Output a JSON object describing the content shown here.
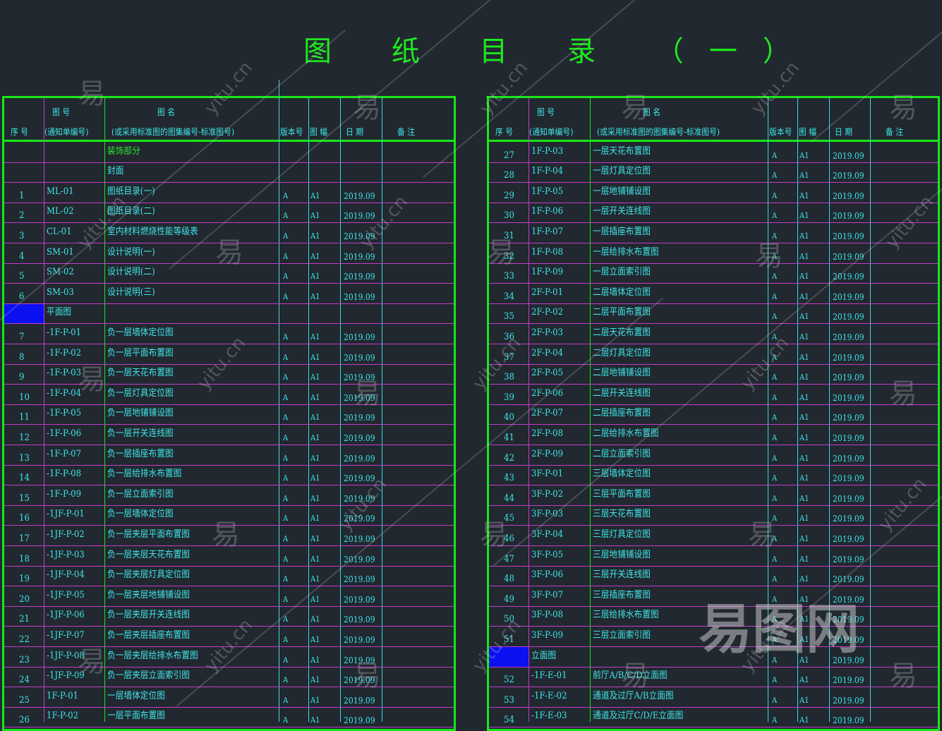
{
  "title": "图 纸 目 录 （一）",
  "colors": {
    "background": "#212830",
    "border": "#19e619",
    "grid": "#c23cc8",
    "text": "#3fe6e6",
    "section_marker": "#0a10f0"
  },
  "headers": {
    "no": "序 号",
    "code_top": "图  号",
    "code_bottom": "(通知单编号)",
    "name_top": "图        名",
    "name_bottom": "(或采用标准图的图集编号-标准图号)",
    "version": "版本号",
    "size": "图 幅",
    "date": "日 期",
    "remark": "备   注"
  },
  "left_rows": [
    {
      "section": "装饰部分",
      "type": "name",
      "color": "green"
    },
    {
      "section": "封面",
      "type": "name"
    },
    {
      "no": "1",
      "code": "ML-01",
      "name": "图纸目录(一)",
      "ver": "A",
      "size": "A1",
      "date": "2019.09"
    },
    {
      "no": "2",
      "code": "ML-02",
      "name": "图纸目录(二)",
      "ver": "A",
      "size": "A1",
      "date": "2019.09"
    },
    {
      "no": "3",
      "code": "CL-01",
      "name": "室内材料燃烧性能等级表",
      "ver": "A",
      "size": "A1",
      "date": "2019.09"
    },
    {
      "no": "4",
      "code": "SM-01",
      "name": "设计说明(一)",
      "ver": "A",
      "size": "A1",
      "date": "2019.09"
    },
    {
      "no": "5",
      "code": "SM-02",
      "name": "设计说明(二)",
      "ver": "A",
      "size": "A1",
      "date": "2019.09"
    },
    {
      "no": "6",
      "code": "SM-03",
      "name": "设计说明(三)",
      "ver": "A",
      "size": "A1",
      "date": "2019.09"
    },
    {
      "section": "平面图",
      "type": "code",
      "marker": true
    },
    {
      "no": "7",
      "code": "-1F-P-01",
      "name": "负一层墙体定位图",
      "ver": "A",
      "size": "A1",
      "date": "2019.09"
    },
    {
      "no": "8",
      "code": "-1F-P-02",
      "name": "负一层平面布置图",
      "ver": "A",
      "size": "A1",
      "date": "2019.09"
    },
    {
      "no": "9",
      "code": "-1F-P-03",
      "name": "负一层天花布置图",
      "ver": "A",
      "size": "A1",
      "date": "2019.09"
    },
    {
      "no": "10",
      "code": "-1F-P-04",
      "name": "负一层灯具定位图",
      "ver": "A",
      "size": "A1",
      "date": "2019.09"
    },
    {
      "no": "11",
      "code": "-1F-P-05",
      "name": "负一层地铺铺设图",
      "ver": "A",
      "size": "A1",
      "date": "2019.09"
    },
    {
      "no": "12",
      "code": "-1F-P-06",
      "name": "负一层开关连线图",
      "ver": "A",
      "size": "A1",
      "date": "2019.09"
    },
    {
      "no": "13",
      "code": "-1F-P-07",
      "name": "负一层插座布置图",
      "ver": "A",
      "size": "A1",
      "date": "2019.09"
    },
    {
      "no": "14",
      "code": "-1F-P-08",
      "name": "负一层给排水布置图",
      "ver": "A",
      "size": "A1",
      "date": "2019.09"
    },
    {
      "no": "15",
      "code": "-1F-P-09",
      "name": "负一层立面索引图",
      "ver": "A",
      "size": "A1",
      "date": "2019.09"
    },
    {
      "no": "16",
      "code": "-1JF-P-01",
      "name": "负一层墙体定位图",
      "ver": "A",
      "size": "A1",
      "date": "2019.09"
    },
    {
      "no": "17",
      "code": "-1JF-P-02",
      "name": "负一层夹层平面布置图",
      "ver": "A",
      "size": "A1",
      "date": "2019.09"
    },
    {
      "no": "18",
      "code": "-1JF-P-03",
      "name": "负一层夹层天花布置图",
      "ver": "A",
      "size": "A1",
      "date": "2019.09"
    },
    {
      "no": "19",
      "code": "-1JF-P-04",
      "name": "负一层夹层灯具定位图",
      "ver": "A",
      "size": "A1",
      "date": "2019.09"
    },
    {
      "no": "20",
      "code": "-1JF-P-05",
      "name": "负一层夹层地铺铺设图",
      "ver": "A",
      "size": "A1",
      "date": "2019.09"
    },
    {
      "no": "21",
      "code": "-1JF-P-06",
      "name": "负一层夹层开关连线图",
      "ver": "A",
      "size": "A1",
      "date": "2019.09"
    },
    {
      "no": "22",
      "code": "-1JF-P-07",
      "name": "负一层夹层插座布置图",
      "ver": "A",
      "size": "A1",
      "date": "2019.09"
    },
    {
      "no": "23",
      "code": "-1JF-P-08",
      "name": "负一层夹层给排水布置图",
      "ver": "A",
      "size": "A1",
      "date": "2019.09"
    },
    {
      "no": "24",
      "code": "-1JF-P-09",
      "name": "负一层夹层立面索引图",
      "ver": "A",
      "size": "A1",
      "date": "2019.09"
    },
    {
      "no": "25",
      "code": "1F-P-01",
      "name": "一层墙体定位图",
      "ver": "A",
      "size": "A1",
      "date": "2019.09"
    },
    {
      "no": "26",
      "code": "1F-P-02",
      "name": "一层平面布置图",
      "ver": "A",
      "size": "A1",
      "date": "2019.09"
    }
  ],
  "right_rows": [
    {
      "no": "27",
      "code": "1F-P-03",
      "name": "一层天花布置图",
      "ver": "A",
      "size": "A1",
      "date": "2019.09"
    },
    {
      "no": "28",
      "code": "1F-P-04",
      "name": "一层灯具定位图",
      "ver": "A",
      "size": "A1",
      "date": "2019.09"
    },
    {
      "no": "29",
      "code": "1F-P-05",
      "name": "一层地铺铺设图",
      "ver": "A",
      "size": "A1",
      "date": "2019.09"
    },
    {
      "no": "30",
      "code": "1F-P-06",
      "name": "一层开关连线图",
      "ver": "A",
      "size": "A1",
      "date": "2019.09"
    },
    {
      "no": "31",
      "code": "1F-P-07",
      "name": "一层插座布置图",
      "ver": "A",
      "size": "A1",
      "date": "2019.09"
    },
    {
      "no": "32",
      "code": "1F-P-08",
      "name": "一层给排水布置图",
      "ver": "A",
      "size": "A1",
      "date": "2019.09"
    },
    {
      "no": "33",
      "code": "1F-P-09",
      "name": "一层立面索引图",
      "ver": "A",
      "size": "A1",
      "date": "2019.09"
    },
    {
      "no": "34",
      "code": "2F-P-01",
      "name": "二层墙体定位图",
      "ver": "A",
      "size": "A1",
      "date": "2019.09"
    },
    {
      "no": "35",
      "code": "2F-P-02",
      "name": "二层平面布置图",
      "ver": "A",
      "size": "A1",
      "date": "2019.09"
    },
    {
      "no": "36",
      "code": "2F-P-03",
      "name": "二层天花布置图",
      "ver": "A",
      "size": "A1",
      "date": "2019.09"
    },
    {
      "no": "37",
      "code": "2F-P-04",
      "name": "二层灯具定位图",
      "ver": "A",
      "size": "A1",
      "date": "2019.09"
    },
    {
      "no": "38",
      "code": "2F-P-05",
      "name": "二层地铺铺设图",
      "ver": "A",
      "size": "A1",
      "date": "2019.09"
    },
    {
      "no": "39",
      "code": "2F-P-06",
      "name": "二层开关连线图",
      "ver": "A",
      "size": "A1",
      "date": "2019.09"
    },
    {
      "no": "40",
      "code": "2F-P-07",
      "name": "二层插座布置图",
      "ver": "A",
      "size": "A1",
      "date": "2019.09"
    },
    {
      "no": "41",
      "code": "2F-P-08",
      "name": "二层给排水布置图",
      "ver": "A",
      "size": "A1",
      "date": "2019.09"
    },
    {
      "no": "42",
      "code": "2F-P-09",
      "name": "二层立面索引图",
      "ver": "A",
      "size": "A1",
      "date": "2019.09"
    },
    {
      "no": "43",
      "code": "3F-P-01",
      "name": "三层墙体定位图",
      "ver": "A",
      "size": "A1",
      "date": "2019.09"
    },
    {
      "no": "44",
      "code": "3F-P-02",
      "name": "三层平面布置图",
      "ver": "A",
      "size": "A1",
      "date": "2019.09"
    },
    {
      "no": "45",
      "code": "3F-P-03",
      "name": "三层天花布置图",
      "ver": "A",
      "size": "A1",
      "date": "2019.09"
    },
    {
      "no": "46",
      "code": "3F-P-04",
      "name": "三层灯具定位图",
      "ver": "A",
      "size": "A1",
      "date": "2019.09"
    },
    {
      "no": "47",
      "code": "3F-P-05",
      "name": "三层地铺铺设图",
      "ver": "A",
      "size": "A1",
      "date": "2019.09"
    },
    {
      "no": "48",
      "code": "3F-P-06",
      "name": "三层开关连线图",
      "ver": "A",
      "size": "A1",
      "date": "2019.09"
    },
    {
      "no": "49",
      "code": "3F-P-07",
      "name": "三层插座布置图",
      "ver": "A",
      "size": "A1",
      "date": "2019.09"
    },
    {
      "no": "50",
      "code": "3F-P-08",
      "name": "三层给排水布置图",
      "ver": "A",
      "size": "A1",
      "date": "2019.09"
    },
    {
      "no": "51",
      "code": "3F-P-09",
      "name": "三层立面索引图",
      "ver": "A",
      "size": "A1",
      "date": "2019.09"
    },
    {
      "section": "立面图",
      "type": "code",
      "marker": true,
      "ver": "A",
      "size": "A1",
      "date": "2019.09"
    },
    {
      "no": "52",
      "code": "-1F-E-01",
      "name": "前厅A/B/C/D立面图",
      "ver": "A",
      "size": "A1",
      "date": "2019.09"
    },
    {
      "no": "53",
      "code": "-1F-E-02",
      "name": "通道及过厅A/B立面图",
      "ver": "A",
      "size": "A1",
      "date": "2019.09"
    },
    {
      "no": "54",
      "code": "-1F-E-03",
      "name": "通道及过厅C/D/E立面图",
      "ver": "A",
      "size": "A1",
      "date": "2019.09"
    }
  ],
  "watermark": {
    "glyph": "易",
    "domain": "yitu.cn",
    "brand": "易图网"
  }
}
